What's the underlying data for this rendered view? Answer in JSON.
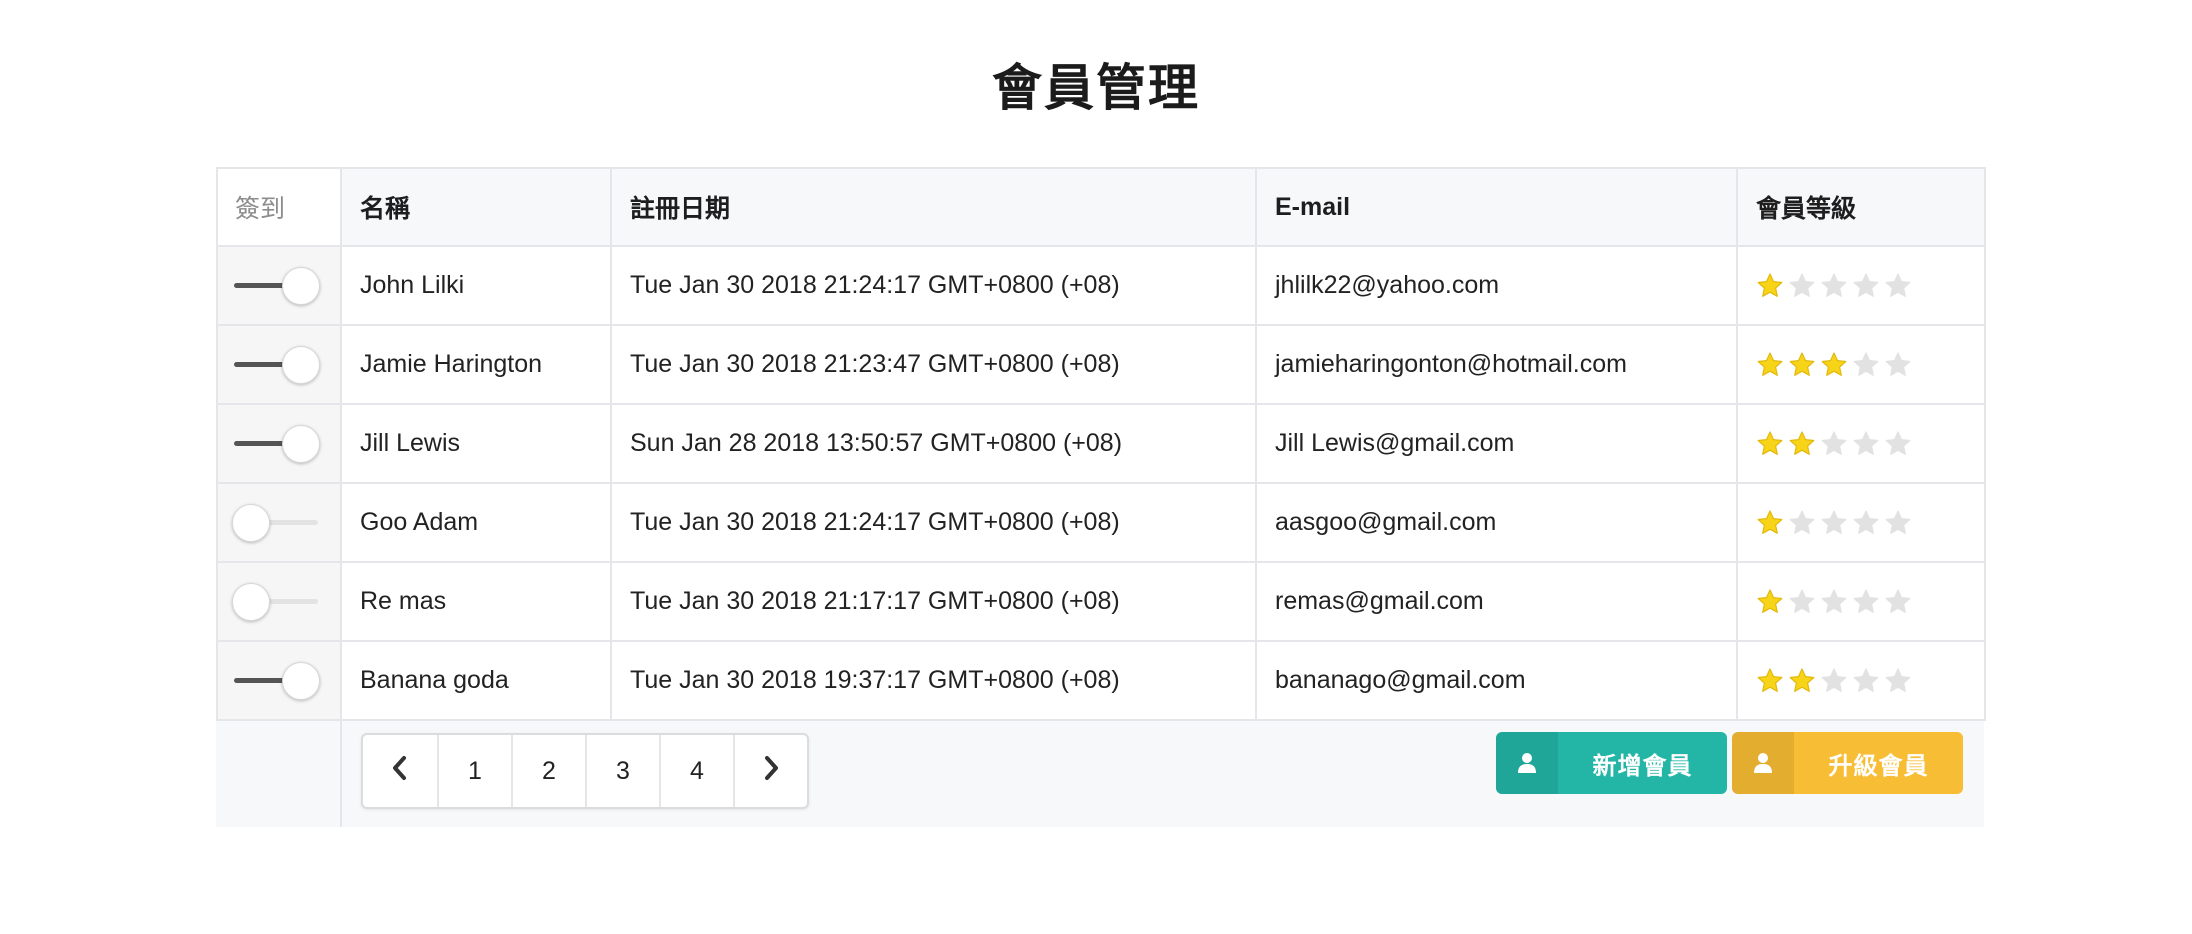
{
  "page": {
    "title": "會員管理"
  },
  "table": {
    "headers": {
      "checkin": "簽到",
      "name": "名稱",
      "registered": "註冊日期",
      "email": "E-mail",
      "level": "會員等級"
    },
    "rows": [
      {
        "checked_in": true,
        "name": "John Lilki",
        "registered": "Tue Jan 30 2018 21:24:17 GMT+0800 (+08)",
        "email": "jhlilk22@yahoo.com",
        "level": 1
      },
      {
        "checked_in": true,
        "name": "Jamie Harington",
        "registered": "Tue Jan 30 2018 21:23:47 GMT+0800 (+08)",
        "email": "jamieharingonton@hotmail.com",
        "level": 3
      },
      {
        "checked_in": true,
        "name": "Jill Lewis",
        "registered": "Sun Jan 28 2018 13:50:57 GMT+0800 (+08)",
        "email": "Jill Lewis@gmail.com",
        "level": 2
      },
      {
        "checked_in": false,
        "name": "Goo Adam",
        "registered": "Tue Jan 30 2018 21:24:17 GMT+0800 (+08)",
        "email": "aasgoo@gmail.com",
        "level": 1
      },
      {
        "checked_in": false,
        "name": "Re mas",
        "registered": "Tue Jan 30 2018 21:17:17 GMT+0800 (+08)",
        "email": "remas@gmail.com",
        "level": 1
      },
      {
        "checked_in": true,
        "name": "Banana goda",
        "registered": "Tue Jan 30 2018 19:37:17 GMT+0800 (+08)",
        "email": "bananago@gmail.com",
        "level": 2
      }
    ],
    "max_level": 5
  },
  "pagination": {
    "pages": [
      "1",
      "2",
      "3",
      "4"
    ],
    "prev_icon": "chevron-left-icon",
    "next_icon": "chevron-right-icon"
  },
  "actions": {
    "add_label": "新增會員",
    "upgrade_label": "升級會員",
    "icon": "user-icon"
  },
  "colors": {
    "star_on": "#f7d417",
    "star_off": "#e2e2e2",
    "add_button": "#23b5a5",
    "upgrade_button": "#f7bd35",
    "toggle_on_track": "#555555"
  }
}
